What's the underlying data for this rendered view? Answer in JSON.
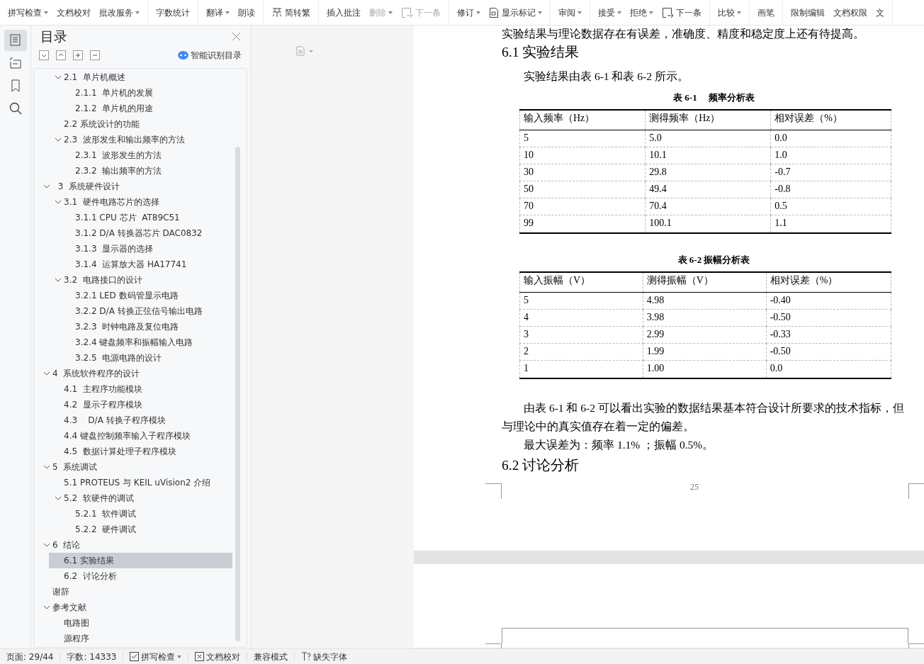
{
  "toolbar": {
    "groups": [
      [
        {
          "label": "拼写检查",
          "dropdown": true,
          "disabled": false
        },
        {
          "label": "文档校对",
          "dropdown": false,
          "disabled": false
        },
        {
          "label": "批改服务",
          "dropdown": true,
          "disabled": false
        }
      ],
      [
        {
          "label": "字数统计",
          "dropdown": false,
          "disabled": false
        }
      ],
      [
        {
          "label": "翻译",
          "dropdown": true,
          "disabled": false
        },
        {
          "label": "朗读",
          "dropdown": false,
          "disabled": false
        }
      ],
      [
        {
          "label": "简转繁",
          "dropdown": false,
          "disabled": false,
          "kind": "convert"
        }
      ],
      [
        {
          "label": "插入批注",
          "dropdown": false,
          "disabled": false
        },
        {
          "label": "删除",
          "dropdown": true,
          "disabled": true
        },
        {
          "label": "下一条",
          "dropdown": false,
          "disabled": true,
          "kind": "next"
        }
      ],
      [
        {
          "label": "修订",
          "dropdown": true,
          "disabled": false
        },
        {
          "label": "显示标记",
          "dropdown": true,
          "disabled": false,
          "kind": "markup"
        }
      ],
      [
        {
          "label": "审阅",
          "dropdown": true,
          "disabled": false
        }
      ],
      [
        {
          "label": "接受",
          "dropdown": true,
          "disabled": false
        },
        {
          "label": "拒绝",
          "dropdown": true,
          "disabled": false
        },
        {
          "label": "下一条",
          "dropdown": false,
          "disabled": false,
          "kind": "next"
        }
      ],
      [
        {
          "label": "比较",
          "dropdown": true,
          "disabled": false
        }
      ],
      [
        {
          "label": "画笔",
          "dropdown": false,
          "disabled": false
        }
      ],
      [
        {
          "label": "限制编辑",
          "dropdown": false,
          "disabled": false
        },
        {
          "label": "文档权限",
          "dropdown": false,
          "disabled": false
        },
        {
          "label": "文",
          "dropdown": false,
          "disabled": false
        }
      ]
    ]
  },
  "rail": [
    {
      "kind": "toc",
      "selected": true
    },
    {
      "kind": "outline",
      "selected": false
    },
    {
      "kind": "bookmark",
      "selected": false
    },
    {
      "kind": "search",
      "selected": false
    }
  ],
  "toc_panel": {
    "title": "目录",
    "smart_button": "智能识别目录",
    "items": [
      {
        "children": [
          {
            "label": "2.1  单片机概述",
            "selected": false,
            "expanded": true,
            "children": [
              {
                "label": "2.1.1  单片机的发展",
                "selected": false
              },
              {
                "label": "2.1.2  单片机的用途",
                "selected": false
              }
            ]
          },
          {
            "label": "2.2 系统设计的功能",
            "selected": false
          },
          {
            "label": "2.3  波形发生和输出频率的方法",
            "selected": false,
            "expanded": true,
            "children": [
              {
                "label": "2.3.1  波形发生的方法",
                "selected": false
              },
              {
                "label": "2.3.2  输出频率的方法",
                "selected": false
              }
            ]
          }
        ]
      },
      {
        "label": "  3  系统硬件设计",
        "selected": false,
        "expanded": true,
        "children": [
          {
            "label": "3.1  硬件电路芯片的选择",
            "selected": false,
            "expanded": true,
            "children": [
              {
                "label": "3.1.1 CPU 芯片  AT89C51",
                "selected": false
              },
              {
                "label": "3.1.2 D/A 转换器芯片 DAC0832",
                "selected": false
              },
              {
                "label": "3.1.3  显示器的选择",
                "selected": false
              },
              {
                "label": "3.1.4  运算放大器 HA17741",
                "selected": false
              }
            ]
          },
          {
            "label": "3.2  电路接口的设计",
            "selected": false,
            "expanded": true,
            "children": [
              {
                "label": "3.2.1 LED 数码管显示电路",
                "selected": false
              },
              {
                "label": "3.2.2 D/A 转换正弦信号输出电路",
                "selected": false
              },
              {
                "label": "3.2.3  时钟电路及复位电路",
                "selected": false
              },
              {
                "label": "3.2.4 键盘频率和振幅输入电路",
                "selected": false
              },
              {
                "label": "3.2.5  电源电路的设计",
                "selected": false
              }
            ]
          }
        ]
      },
      {
        "label": "4  系统软件程序的设计",
        "selected": false,
        "expanded": true,
        "children": [
          {
            "label": "4.1  主程序功能模块",
            "selected": false
          },
          {
            "label": "4.2  显示子程序模块",
            "selected": false
          },
          {
            "label": "4.3    D/A 转换子程序模块",
            "selected": false
          },
          {
            "label": "4.4 键盘控制频率输入子程序模块",
            "selected": false
          },
          {
            "label": "4.5  数据计算处理子程序模块",
            "selected": false
          }
        ]
      },
      {
        "label": "5  系统调试",
        "selected": false,
        "expanded": true,
        "children": [
          {
            "label": "5.1 PROTEUS 与 KEIL uVision2 介绍",
            "selected": false
          },
          {
            "label": "5.2  软硬件的调试",
            "selected": false,
            "expanded": true,
            "children": [
              {
                "label": "5.2.1  软件调试",
                "selected": false
              },
              {
                "label": "5.2.2  硬件调试",
                "selected": false
              }
            ]
          }
        ]
      },
      {
        "label": "6  结论",
        "selected": false,
        "expanded": true,
        "children": [
          {
            "label": "6.1 实验结果",
            "selected": true
          },
          {
            "label": "6.2  讨论分析",
            "selected": false
          }
        ]
      },
      {
        "label": "谢辞",
        "selected": false
      },
      {
        "label": "参考文献",
        "selected": false,
        "expanded": true,
        "children": [
          {
            "label": "电路图",
            "selected": false
          },
          {
            "label": "源程序",
            "selected": false
          }
        ]
      }
    ]
  },
  "document": {
    "blocks": [
      {
        "kind": "para",
        "text": "实验结果与理论数据存在有误差，准确度、精度和稳定度上还有待提高。"
      },
      {
        "kind": "heading",
        "text": "6.1 实验结果"
      },
      {
        "kind": "indent",
        "text": "实验结果由表 6-1 和表 6-2 所示。"
      },
      {
        "kind": "caption",
        "text": "表 6-1　 频率分析表"
      },
      {
        "kind": "table",
        "columns": [
          "输入频率（Hz）",
          "测得频率（Hz）",
          "相对误差（%）"
        ],
        "rows": [
          [
            "5",
            "5.0",
            "0.0"
          ],
          [
            "10",
            "10.1",
            "1.0"
          ],
          [
            "30",
            "29.8",
            "-0.7"
          ],
          [
            "50",
            "49.4",
            "-0.8"
          ],
          [
            "70",
            "70.4",
            "0.5"
          ],
          [
            "99",
            "100.1",
            "1.1"
          ]
        ]
      },
      {
        "kind": "caption",
        "text": "表 6-2  振幅分析表"
      },
      {
        "kind": "table",
        "columns": [
          "输入振幅（V）",
          "测得振幅（V）",
          "相对误差（%）"
        ],
        "rows": [
          [
            "5",
            "4.98",
            "-0.40"
          ],
          [
            "4",
            "3.98",
            "-0.50"
          ],
          [
            "3",
            "2.99",
            "-0.33"
          ],
          [
            "2",
            "1.99",
            "-0.50"
          ],
          [
            "1",
            "1.00",
            "0.0"
          ]
        ]
      },
      {
        "kind": "indent",
        "text": "由表 6-1 和 6-2 可以看出实验的数据结果基本符合设计所要求的技术指标，但与理论中的真实值存在着一定的偏差。"
      },
      {
        "kind": "indent",
        "text": "最大误差为：频率  1.1% ；振幅  0.5%。"
      },
      {
        "kind": "heading",
        "text": "6.2  讨论分析"
      }
    ],
    "page_number": "25"
  },
  "status_bar": [
    {
      "kind": "text",
      "label": "页面: 29/44"
    },
    {
      "kind": "text",
      "label": "字数: 14333"
    },
    {
      "kind": "check",
      "label": "拼写检查",
      "dropdown": true
    },
    {
      "kind": "cross",
      "label": "文档校对",
      "dropdown": false
    },
    {
      "kind": "text",
      "label": "兼容模式"
    },
    {
      "kind": "font",
      "label": "缺失字体"
    }
  ]
}
